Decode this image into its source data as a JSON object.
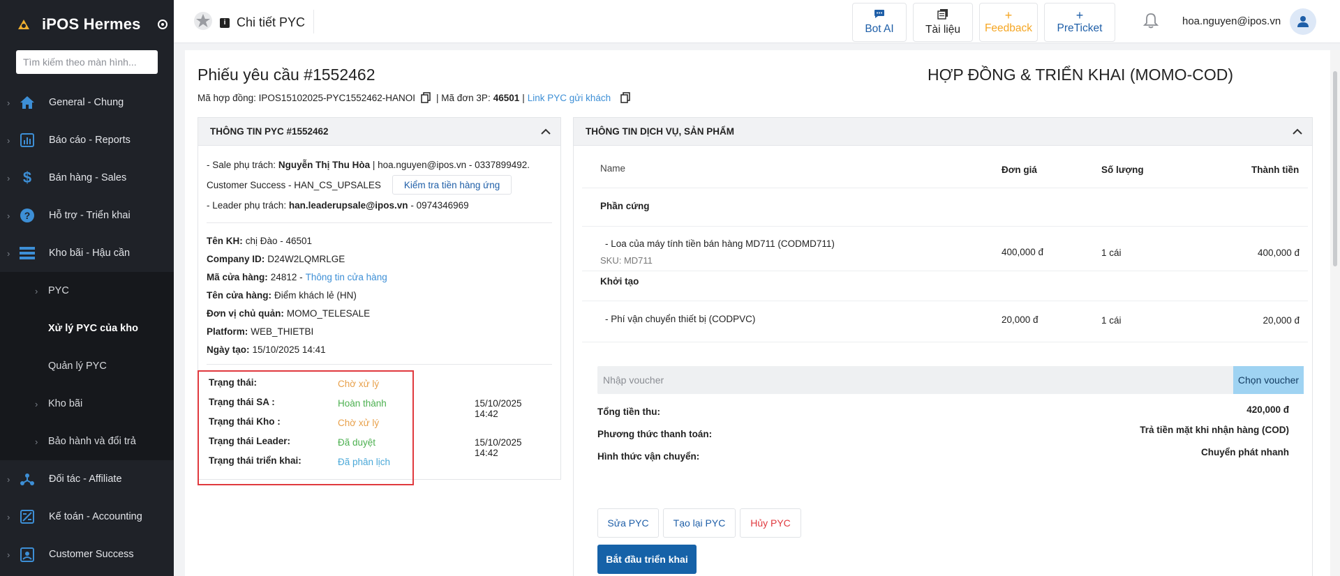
{
  "app": {
    "name": "iPOS Hermes"
  },
  "sidebar": {
    "search_placeholder": "Tìm kiếm theo màn hình...",
    "items": [
      {
        "label": "General - Chung",
        "icon": "home-icon"
      },
      {
        "label": "Báo cáo - Reports",
        "icon": "report-icon"
      },
      {
        "label": "Bán hàng - Sales",
        "icon": "dollar-icon"
      },
      {
        "label": "Hỗ trợ - Triển khai",
        "icon": "help-icon"
      },
      {
        "label": "Kho bãi - Hậu cần",
        "icon": "warehouse-icon"
      }
    ],
    "sub_items": [
      {
        "label": "PYC"
      },
      {
        "label": "Xử lý PYC của kho"
      },
      {
        "label": "Quản lý PYC"
      },
      {
        "label": "Kho bãi"
      },
      {
        "label": "Bảo hành và đổi trả"
      }
    ],
    "bottom_items": [
      {
        "label": "Đối tác - Affiliate",
        "icon": "affiliate-icon"
      },
      {
        "label": "Kế toán - Accounting",
        "icon": "accounting-icon"
      },
      {
        "label": "Customer Success",
        "icon": "customer-success-icon"
      }
    ]
  },
  "topbar": {
    "title": "Chi tiết PYC",
    "buttons": {
      "bot_ai": "Bot AI",
      "docs": "Tài liệu",
      "feedback": "Feedback",
      "preticket": "PreTicket"
    },
    "user_email": "hoa.nguyen@ipos.vn",
    "colors": {
      "accent": "#1f5fa8",
      "feedback": "#f5a623"
    }
  },
  "page": {
    "title": "Phiếu yêu cầu #1552462",
    "right_title": "HỢP ĐỒNG & TRIỂN KHAI (MOMO-COD)",
    "contract_prefix": "Mã hợp đồng: IPOS15102025-PYC1552462-HANOI",
    "order_3p_prefix": "| Mã đơn 3P:",
    "order_3p_value": "46501",
    "separator": "|",
    "link_label": "Link PYC gửi khách"
  },
  "left_panel": {
    "header": "THÔNG TIN PYC #1552462",
    "sale_prefix": "- Sale phụ trách:",
    "sale_name": "Nguyễn Thị Thu Hòa",
    "sale_contact": "| hoa.nguyen@ipos.vn - 0337899492.",
    "cs_text": "Customer Success - HAN_CS_UPSALES",
    "check_button": "Kiểm tra tiền hàng ứng",
    "leader_prefix": "- Leader phụ trách:",
    "leader_email": "han.leaderupsale@ipos.vn",
    "leader_phone": "- 0974346969",
    "fields": [
      {
        "label": "Tên KH:",
        "value": "chị Đào - 46501"
      },
      {
        "label": "Company ID:",
        "value": "D24W2LQMRLGE"
      },
      {
        "label": "Mã cửa hàng:",
        "value": "24812 -",
        "link": "Thông tin cửa hàng"
      },
      {
        "label": "Tên cửa hàng:",
        "value": "Điểm khách lẻ (HN)"
      },
      {
        "label": "Đơn vị chủ quản:",
        "value": "MOMO_TELESALE"
      },
      {
        "label": "Platform:",
        "value": "WEB_THIETBI"
      },
      {
        "label": "Ngày tạo:",
        "value": "15/10/2025 14:41"
      }
    ],
    "statuses": [
      {
        "label": "Trạng thái:",
        "value": "Chờ xử lý",
        "color": "#e8a04a",
        "time": ""
      },
      {
        "label": "Trạng thái SA :",
        "value": "Hoàn thành",
        "color": "#4cb050",
        "time": "15/10/2025 14:42"
      },
      {
        "label": "Trạng thái Kho :",
        "value": "Chờ xử lý",
        "color": "#e8a04a",
        "time": ""
      },
      {
        "label": "Trạng thái Leader:",
        "value": "Đã duyệt",
        "color": "#4cb050",
        "time": "15/10/2025 14:42"
      },
      {
        "label": "Trạng thái triển khai:",
        "value": "Đã phân lịch",
        "color": "#4aa8d8",
        "time": ""
      }
    ]
  },
  "right_panel": {
    "header": "THÔNG TIN DỊCH VỤ, SẢN PHẨM",
    "columns": {
      "name": "Name",
      "price": "Đơn giá",
      "qty": "Số lượng",
      "total": "Thành tiền"
    },
    "groups": [
      {
        "title": "Phần cứng",
        "items": [
          {
            "name": "- Loa của máy tính tiền bán hàng MD711 (CODMD711)",
            "sku": "SKU: MD711",
            "price": "400,000 đ",
            "qty": "1 cái",
            "total": "400,000 đ"
          }
        ]
      },
      {
        "title": "Khởi tạo",
        "items": [
          {
            "name": "- Phí vận chuyển thiết bị (CODPVC)",
            "sku": "",
            "price": "20,000 đ",
            "qty": "1 cái",
            "total": "20,000 đ"
          }
        ]
      }
    ],
    "voucher_placeholder": "Nhập voucher",
    "voucher_button": "Chọn voucher",
    "summary": [
      {
        "label": "Tổng tiền thu:",
        "value": "420,000 đ"
      },
      {
        "label": "Phương thức thanh toán:",
        "value": "Trả tiền mặt khi nhận hàng (COD)"
      },
      {
        "label": "Hình thức vận chuyển:",
        "value": "Chuyển phát nhanh"
      }
    ],
    "actions": {
      "edit": "Sửa PYC",
      "recreate": "Tạo lại PYC",
      "cancel": "Hủy PYC",
      "start": "Bắt đầu triển khai"
    }
  }
}
